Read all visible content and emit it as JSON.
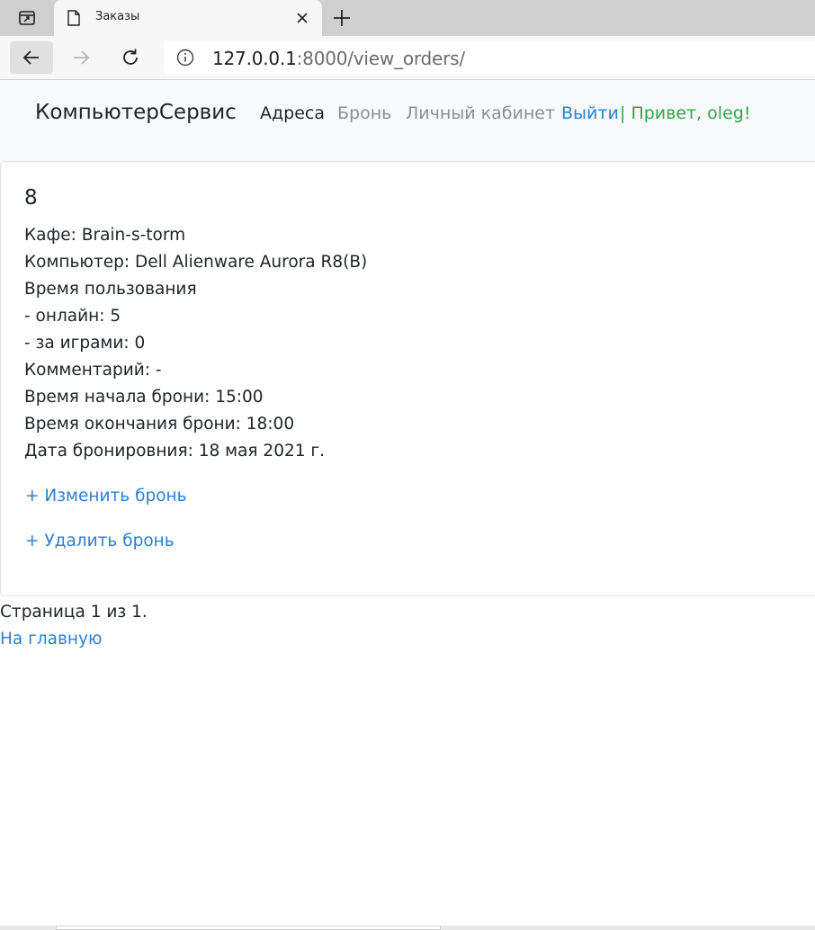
{
  "browser": {
    "tab_title": "Заказы",
    "url_host": "127.0.0.1",
    "url_rest": ":8000/view_orders/",
    "icons": {
      "tab_actions": "tab-actions-icon",
      "page": "page-icon",
      "close": "close-icon",
      "new_tab": "plus-icon",
      "back": "arrow-left-icon",
      "forward": "arrow-right-icon",
      "reload": "reload-icon",
      "info": "info-icon"
    }
  },
  "navbar": {
    "brand": "КомпьютерСервис",
    "links": {
      "addresses": "Адреса",
      "booking": "Бронь",
      "cabinet": "Личный кабинет",
      "logout": "Выйти"
    },
    "greeting": "| Привет, oleg!"
  },
  "order": {
    "id": "8",
    "cafe": "Кафе: Brain-s-torm",
    "computer": "Компьютер: Dell Alienware Aurora R8(B)",
    "usage_title": "Время пользования",
    "online": "- онлайн: 5",
    "gaming": "- за играми: 0",
    "comment": "Комментарий: -",
    "start": "Время начала брони: 15:00",
    "end": "Время окончания брони: 18:00",
    "date": "Дата бронировния: 18 мая 2021 г.",
    "edit_link": "+ Изменить бронь",
    "delete_link": "+ Удалить бронь"
  },
  "pagination": {
    "text": "Страница 1 из 1."
  },
  "home_link": "На главную",
  "colors": {
    "link": "#2f7fd1",
    "greeting": "#35a34a",
    "muted_nav": "#8a8f94",
    "navbar_bg": "#f8f9fa"
  }
}
